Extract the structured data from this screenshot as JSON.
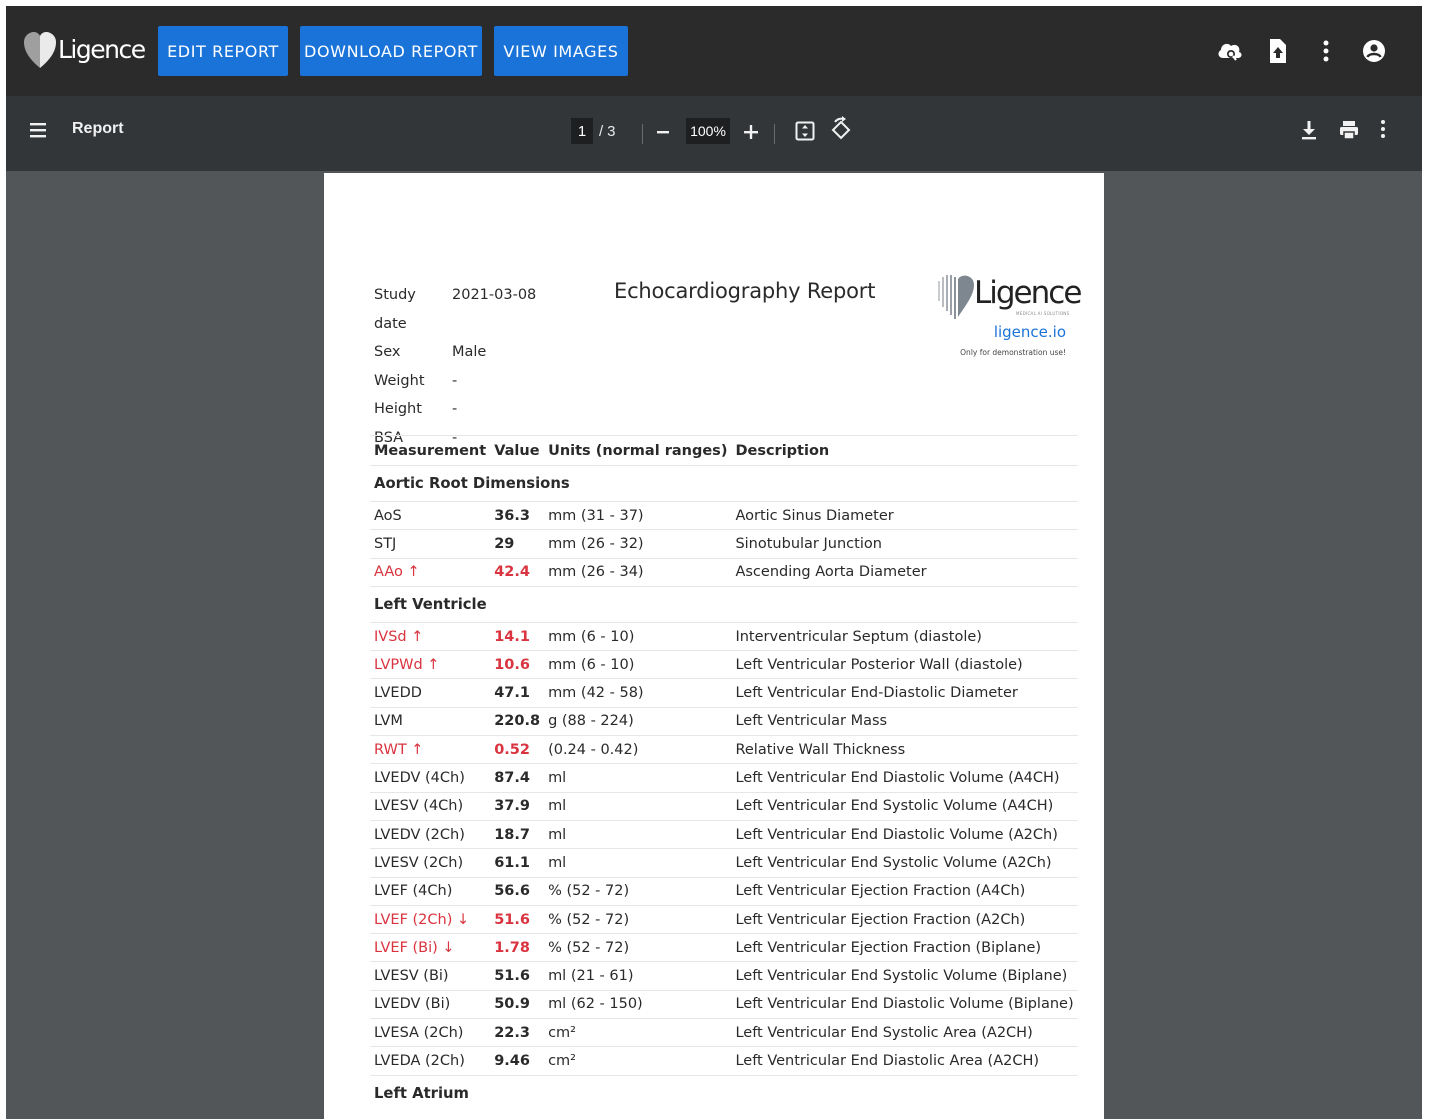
{
  "app_bar": {
    "logo_text": "Ligence",
    "buttons": [
      "EDIT REPORT",
      "DOWNLOAD REPORT",
      "VIEW IMAGES"
    ],
    "icons": [
      "cloud-search-icon",
      "file-upload-icon",
      "more-vert-icon",
      "account-icon"
    ]
  },
  "viewer": {
    "title": "Report",
    "page_current": "1",
    "page_sep": "/",
    "page_total": "3",
    "zoom": "100%"
  },
  "report": {
    "title": "Echocardiography Report",
    "info": [
      {
        "label": "Study date",
        "value": "2021-03-08"
      },
      {
        "label": "Sex",
        "value": "Male"
      },
      {
        "label": "Weight",
        "value": "-"
      },
      {
        "label": "Height",
        "value": "-"
      },
      {
        "label": "BSA",
        "value": "-"
      }
    ],
    "logo": {
      "brand": "Ligence",
      "sub": "MEDICAL AI SOLUTIONS",
      "site": "ligence.io",
      "note": "Only for demonstration use!"
    },
    "headers": {
      "measurement": "Measurement",
      "value": "Value",
      "units": "Units (normal ranges)",
      "description": "Description"
    },
    "sections": [
      {
        "title": "Aortic Root Dimensions",
        "rows": [
          {
            "name": "AoS",
            "value": "36.3",
            "units": "mm (31 - 37)",
            "desc": "Aortic Sinus Diameter",
            "flag": ""
          },
          {
            "name": "STJ",
            "value": "29",
            "units": "mm (26 - 32)",
            "desc": "Sinotubular Junction",
            "flag": ""
          },
          {
            "name": "AAo ↑",
            "value": "42.4",
            "units": "mm (26 - 34)",
            "desc": "Ascending Aorta Diameter",
            "flag": "high"
          }
        ]
      },
      {
        "title": "Left Ventricle",
        "rows": [
          {
            "name": "IVSd ↑",
            "value": "14.1",
            "units": "mm (6 - 10)",
            "desc": "Interventricular Septum (diastole)",
            "flag": "high"
          },
          {
            "name": "LVPWd ↑",
            "value": "10.6",
            "units": "mm (6 - 10)",
            "desc": "Left Ventricular Posterior Wall (diastole)",
            "flag": "high"
          },
          {
            "name": "LVEDD",
            "value": "47.1",
            "units": "mm (42 - 58)",
            "desc": "Left Ventricular End-Diastolic Diameter",
            "flag": ""
          },
          {
            "name": "LVM",
            "value": "220.8",
            "units": "g (88 - 224)",
            "desc": "Left Ventricular Mass",
            "flag": ""
          },
          {
            "name": "RWT ↑",
            "value": "0.52",
            "units": "(0.24 - 0.42)",
            "desc": "Relative Wall Thickness",
            "flag": "high"
          },
          {
            "name": "LVEDV (4Ch)",
            "value": "87.4",
            "units": "ml",
            "desc": "Left Ventricular End Diastolic Volume (A4CH)",
            "flag": ""
          },
          {
            "name": "LVESV (4Ch)",
            "value": "37.9",
            "units": "ml",
            "desc": "Left Ventricular End Systolic Volume (A4CH)",
            "flag": ""
          },
          {
            "name": "LVEDV (2Ch)",
            "value": "18.7",
            "units": "ml",
            "desc": "Left Ventricular End Diastolic Volume (A2Ch)",
            "flag": ""
          },
          {
            "name": "LVESV (2Ch)",
            "value": "61.1",
            "units": "ml",
            "desc": "Left Ventricular End Systolic Volume (A2Ch)",
            "flag": ""
          },
          {
            "name": "LVEF (4Ch)",
            "value": "56.6",
            "units": "% (52 - 72)",
            "desc": "Left Ventricular Ejection Fraction (A4Ch)",
            "flag": ""
          },
          {
            "name": "LVEF (2Ch) ↓",
            "value": "51.6",
            "units": "% (52 - 72)",
            "desc": "Left Ventricular Ejection Fraction (A2Ch)",
            "flag": "low"
          },
          {
            "name": "LVEF (Bi) ↓",
            "value": "1.78",
            "units": "% (52 - 72)",
            "desc": "Left Ventricular Ejection Fraction (Biplane)",
            "flag": "low"
          },
          {
            "name": "LVESV (Bi)",
            "value": "51.6",
            "units": "ml (21 - 61)",
            "desc": "Left Ventricular End Systolic Volume (Biplane)",
            "flag": ""
          },
          {
            "name": "LVEDV (Bi)",
            "value": "50.9",
            "units": "ml (62 - 150)",
            "desc": "Left Ventricular End Diastolic Volume (Biplane)",
            "flag": ""
          },
          {
            "name": "LVESA (2Ch)",
            "value": "22.3",
            "units": "cm²",
            "desc": "Left Ventricular End Systolic Area (A2CH)",
            "flag": ""
          },
          {
            "name": "LVEDA (2Ch)",
            "value": "9.46",
            "units": "cm²",
            "desc": "Left Ventricular End Diastolic Area (A2CH)",
            "flag": ""
          }
        ]
      },
      {
        "title": "Left Atrium",
        "rows": []
      }
    ]
  },
  "colors": {
    "app_bar": "#2b2b2b",
    "button": "#1a73d8",
    "viewer_bar": "#323639",
    "canvas": "#525659",
    "flag": "#d9343f",
    "link": "#1a73d8"
  }
}
